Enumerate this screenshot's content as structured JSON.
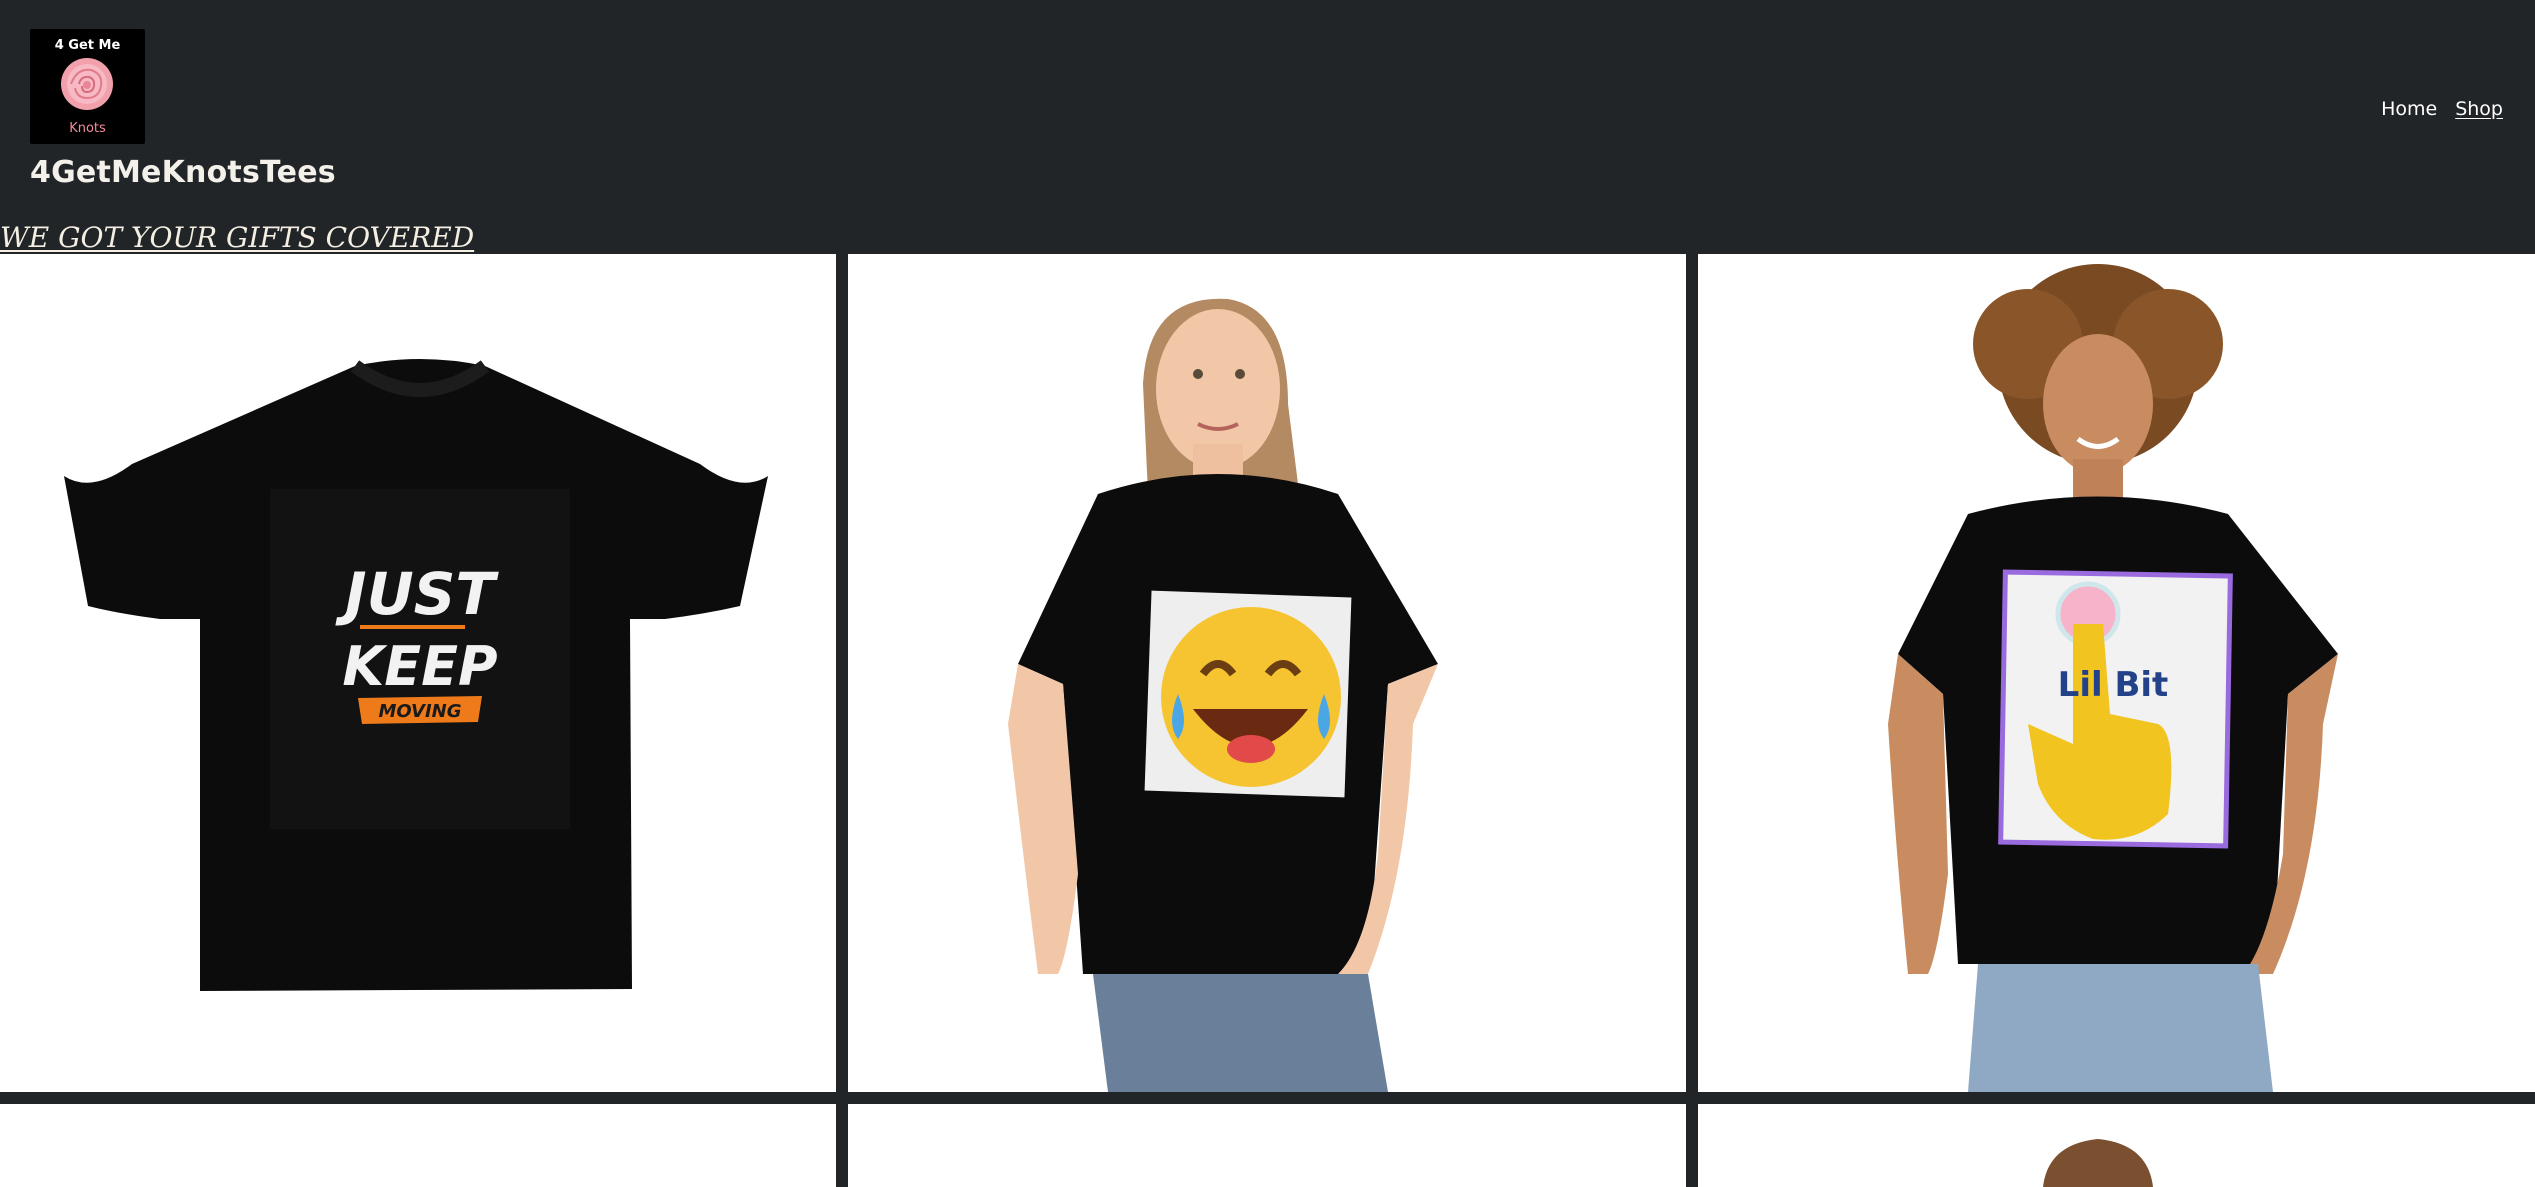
{
  "site": {
    "logo_top": "4 Get Me",
    "logo_bottom": "Knots",
    "title": "4GetMeKnotsTees",
    "tagline": "WE GOT YOUR GIFTS COVERED"
  },
  "nav": {
    "items": [
      {
        "label": "Home",
        "active": false
      },
      {
        "label": "Shop",
        "active": true
      }
    ]
  },
  "products": [
    {
      "design_line1": "JUST",
      "design_line2": "KEEP",
      "design_line3": "MOVING"
    },
    {
      "design": "laughing-tears-emoji"
    },
    {
      "design_text": "Lil Bit"
    }
  ],
  "colors": {
    "header_bg": "#212528",
    "tile_bg": "#ffffff",
    "shirt": "#0c0c0c",
    "accent_orange": "#ef7a1a",
    "emoji_yellow": "#f6c431",
    "lilbit_blue": "#23428a"
  }
}
